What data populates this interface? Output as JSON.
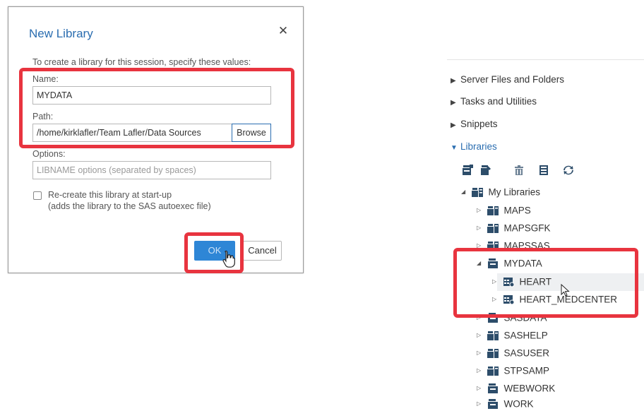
{
  "dialog": {
    "title": "New Library",
    "close_symbol": "✕",
    "instruction": "To create a library for this session, specify these values:",
    "name_label": "Name:",
    "name_value": "MYDATA",
    "path_label": "Path:",
    "path_value": "/home/kirklafler/Team Lafler/Data Sources",
    "browse_label": "Browse",
    "options_label": "Options:",
    "options_placeholder": "LIBNAME options (separated by spaces)",
    "recreate_line1": "Re-create this library at start-up",
    "recreate_line2": "(adds the library to the SAS autoexec file)",
    "ok_label": "OK",
    "cancel_label": "Cancel"
  },
  "nav": {
    "sections": [
      {
        "label": "Server Files and Folders",
        "expanded": false
      },
      {
        "label": "Tasks and Utilities",
        "expanded": false
      },
      {
        "label": "Snippets",
        "expanded": false
      },
      {
        "label": "Libraries",
        "expanded": true
      }
    ],
    "toolbar_icons": [
      "new-library-icon",
      "properties-icon",
      "delete-icon",
      "table-view-icon",
      "refresh-icon"
    ],
    "tree": {
      "root": "My Libraries",
      "libraries": [
        "MAPS",
        "MAPSGFK",
        "MAPSSAS",
        "MYDATA",
        "SASDATA",
        "SASHELP",
        "SASUSER",
        "STPSAMP",
        "WEBWORK",
        "WORK"
      ],
      "mydata_tables": [
        "HEART",
        "HEART_MEDCENTER"
      ]
    }
  },
  "colors": {
    "highlight": "#e8343f",
    "accent": "#2a6db0",
    "ok_button": "#2e86d6"
  }
}
